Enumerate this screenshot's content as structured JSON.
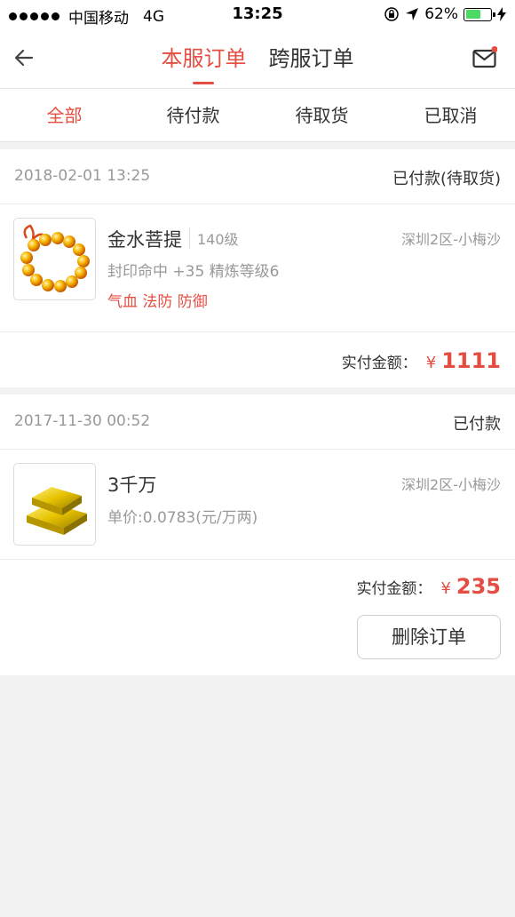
{
  "status_bar": {
    "carrier": "中国移动",
    "network": "4G",
    "time": "13:25",
    "battery": "62%",
    "battery_level": 0.62,
    "icons": [
      "signal-dots",
      "orientation-lock-icon",
      "location-arrow-icon",
      "battery-icon",
      "charging-bolt-icon"
    ]
  },
  "nav": {
    "tabs": [
      "本服订单",
      "跨服订单"
    ],
    "active_tab": 0,
    "icons": [
      "back-arrow-icon",
      "mail-icon"
    ],
    "accent_color": "#e54d42"
  },
  "filters": {
    "tabs": [
      "全部",
      "待付款",
      "待取货",
      "已取消"
    ],
    "active": 0
  },
  "orders": [
    {
      "date": "2018-02-01 13:25",
      "status": "已付款(待取货)",
      "item": {
        "name": "金水菩提",
        "level": "140级",
        "server": "深圳2区-小梅沙",
        "desc": "封印命中 +35 精炼等级6",
        "attrs": "气血 法防 防御",
        "image": "prayer-beads-icon"
      },
      "pay_label": "实付金额：",
      "currency": "¥",
      "amount": "1111"
    },
    {
      "date": "2017-11-30 00:52",
      "status": "已付款",
      "item": {
        "name": "3千万",
        "server": "深圳2区-小梅沙",
        "desc": "单价:0.0783(元/万两)",
        "image": "gold-bars-icon"
      },
      "pay_label": "实付金额：",
      "currency": "¥",
      "amount": "235",
      "delete_label": "删除订单"
    }
  ]
}
